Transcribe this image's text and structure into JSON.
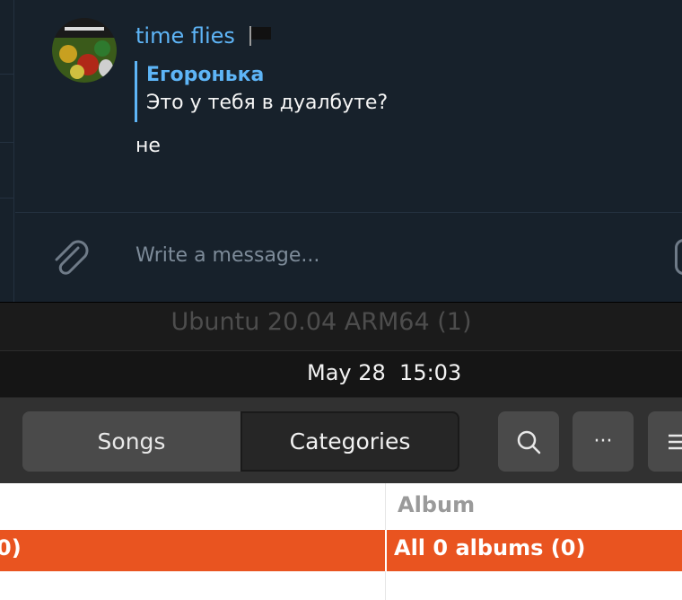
{
  "telegram": {
    "sender_name": "time flies",
    "reply": {
      "author": "Егоронька",
      "text": "Это у тебя в дуалбуте?"
    },
    "message_text": "не",
    "compose_placeholder": "Write a message...",
    "accent_color": "#5eb5f7"
  },
  "vm_window": {
    "title": "Ubuntu 20.04 ARM64 (1)"
  },
  "top_bar": {
    "clock": "May 28  15:03"
  },
  "rhythmbox": {
    "tabs": [
      {
        "label": "Songs",
        "selected": false
      },
      {
        "label": "Categories",
        "selected": true
      }
    ],
    "buttons": [
      "search-icon",
      "more-icon",
      "menu-icon"
    ],
    "more_label": "···",
    "browser": {
      "column_header": "Album",
      "selected_row_left": "0)",
      "selected_row_right": "All 0 albums (0)",
      "selection_color": "#e95420"
    }
  }
}
